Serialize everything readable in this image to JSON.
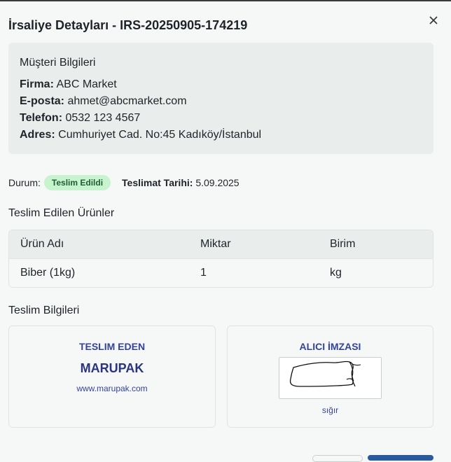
{
  "modal": {
    "title": "İrsaliye Detayları - IRS-20250905-174219",
    "close_icon": "close-icon"
  },
  "customer": {
    "heading": "Müşteri Bilgileri",
    "firma_label": "Firma:",
    "firma_value": "ABC Market",
    "eposta_label": "E-posta:",
    "eposta_value": "ahmet@abcmarket.com",
    "telefon_label": "Telefon:",
    "telefon_value": "0532 123 4567",
    "adres_label": "Adres:",
    "adres_value": "Cumhuriyet Cad. No:45 Kadıköy/İstanbul"
  },
  "status": {
    "label": "Durum:",
    "badge": "Teslim Edildi",
    "date_label": "Teslimat Tarihi:",
    "date_value": "5.09.2025",
    "badge_color": "#c8f3cf"
  },
  "products": {
    "title": "Teslim Edilen Ürünler",
    "columns": [
      "Ürün Adı",
      "Miktar",
      "Birim"
    ],
    "rows": [
      {
        "name": "Biber (1kg)",
        "qty": "1",
        "unit": "kg"
      }
    ]
  },
  "delivery": {
    "title": "Teslim Bilgileri",
    "sender_label": "TESLIM EDEN",
    "company": "MARUPAK",
    "website": "www.marupak.com",
    "receiver_label": "ALICI İMZASI",
    "receiver_name": "sığır",
    "accent_color": "#34439b"
  }
}
